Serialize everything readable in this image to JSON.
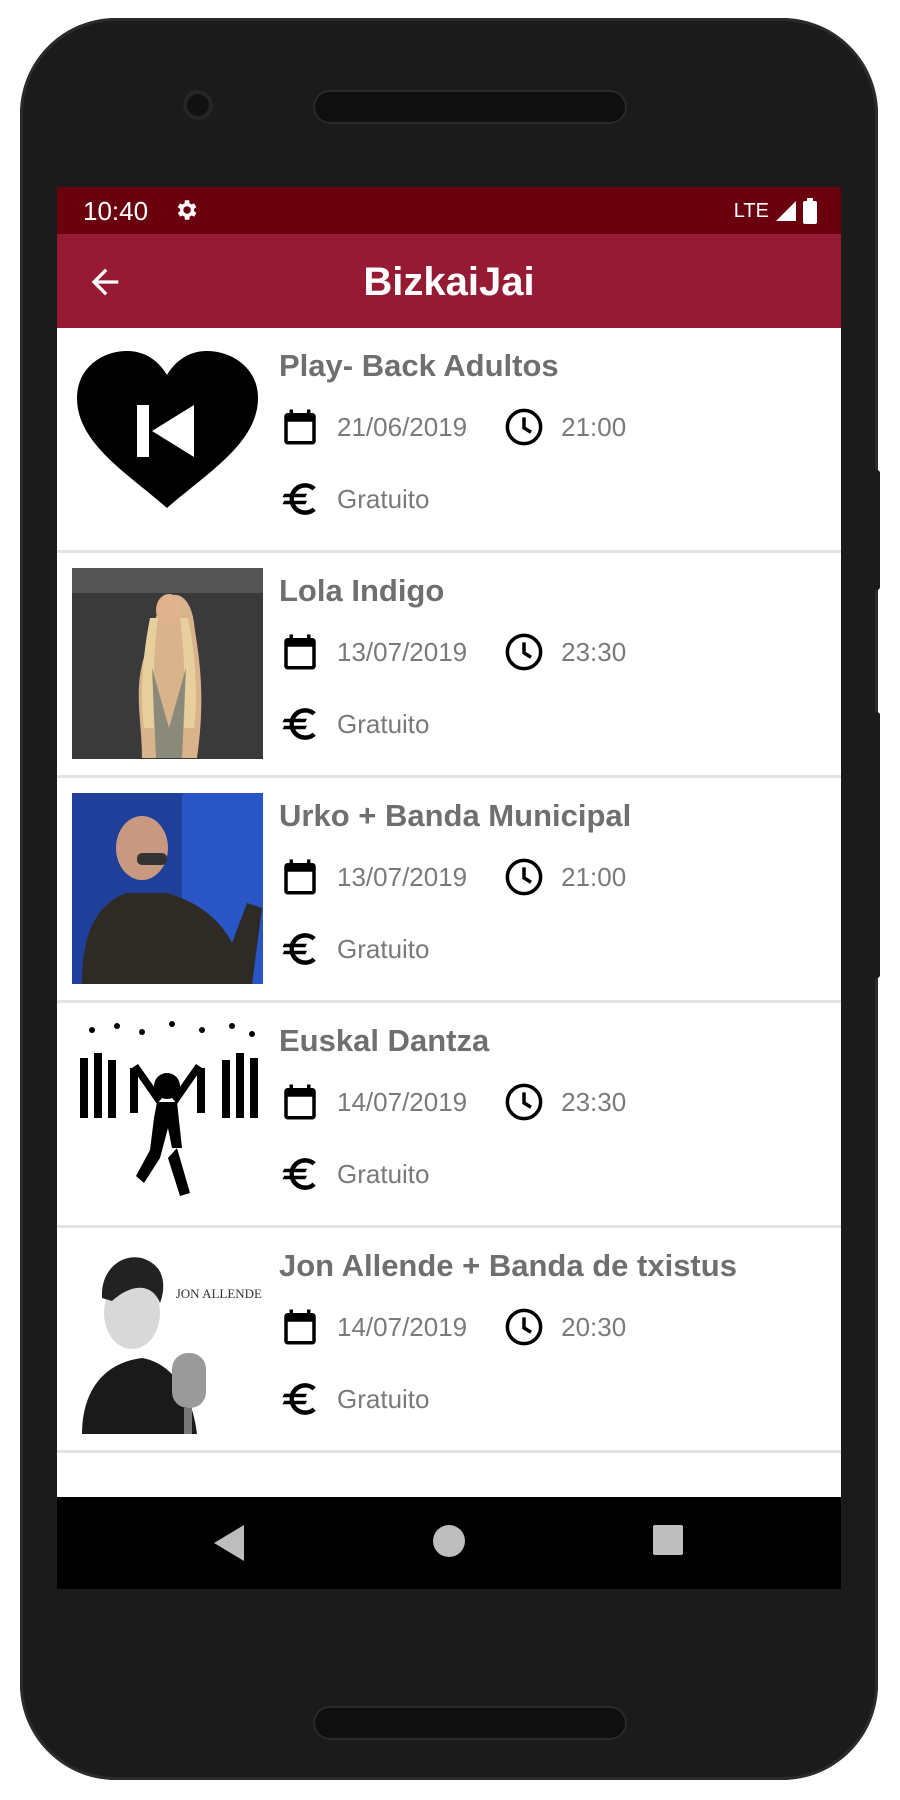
{
  "status": {
    "time": "10:40",
    "network": "LTE"
  },
  "app": {
    "title": "BizkaiJai"
  },
  "events": [
    {
      "title": "Play- Back Adultos",
      "date": "21/06/2019",
      "time": "21:00",
      "price": "Gratuito",
      "image": "heart-rewind-logo"
    },
    {
      "title": "Lola Indigo",
      "date": "13/07/2019",
      "time": "23:30",
      "price": "Gratuito",
      "image": "singer-photo"
    },
    {
      "title": "Urko + Banda Municipal",
      "date": "13/07/2019",
      "time": "21:00",
      "price": "Gratuito",
      "image": "singer-photo"
    },
    {
      "title": "Euskal Dantza",
      "date": "14/07/2019",
      "time": "23:30",
      "price": "Gratuito",
      "image": "dancing-crowd-icon"
    },
    {
      "title": "Jon Allende + Banda de txistus",
      "date": "14/07/2019",
      "time": "20:30",
      "price": "Gratuito",
      "image": "singer-photo",
      "image_text": "JON ALLENDE"
    }
  ],
  "icons": {
    "date": "calendar-icon",
    "time": "clock-icon",
    "price": "euro-icon"
  },
  "colors": {
    "statusbar": "#6a000e",
    "appbar": "#961a33",
    "title_text": "#6f6f6f",
    "detail_text": "#7a7a7a"
  }
}
